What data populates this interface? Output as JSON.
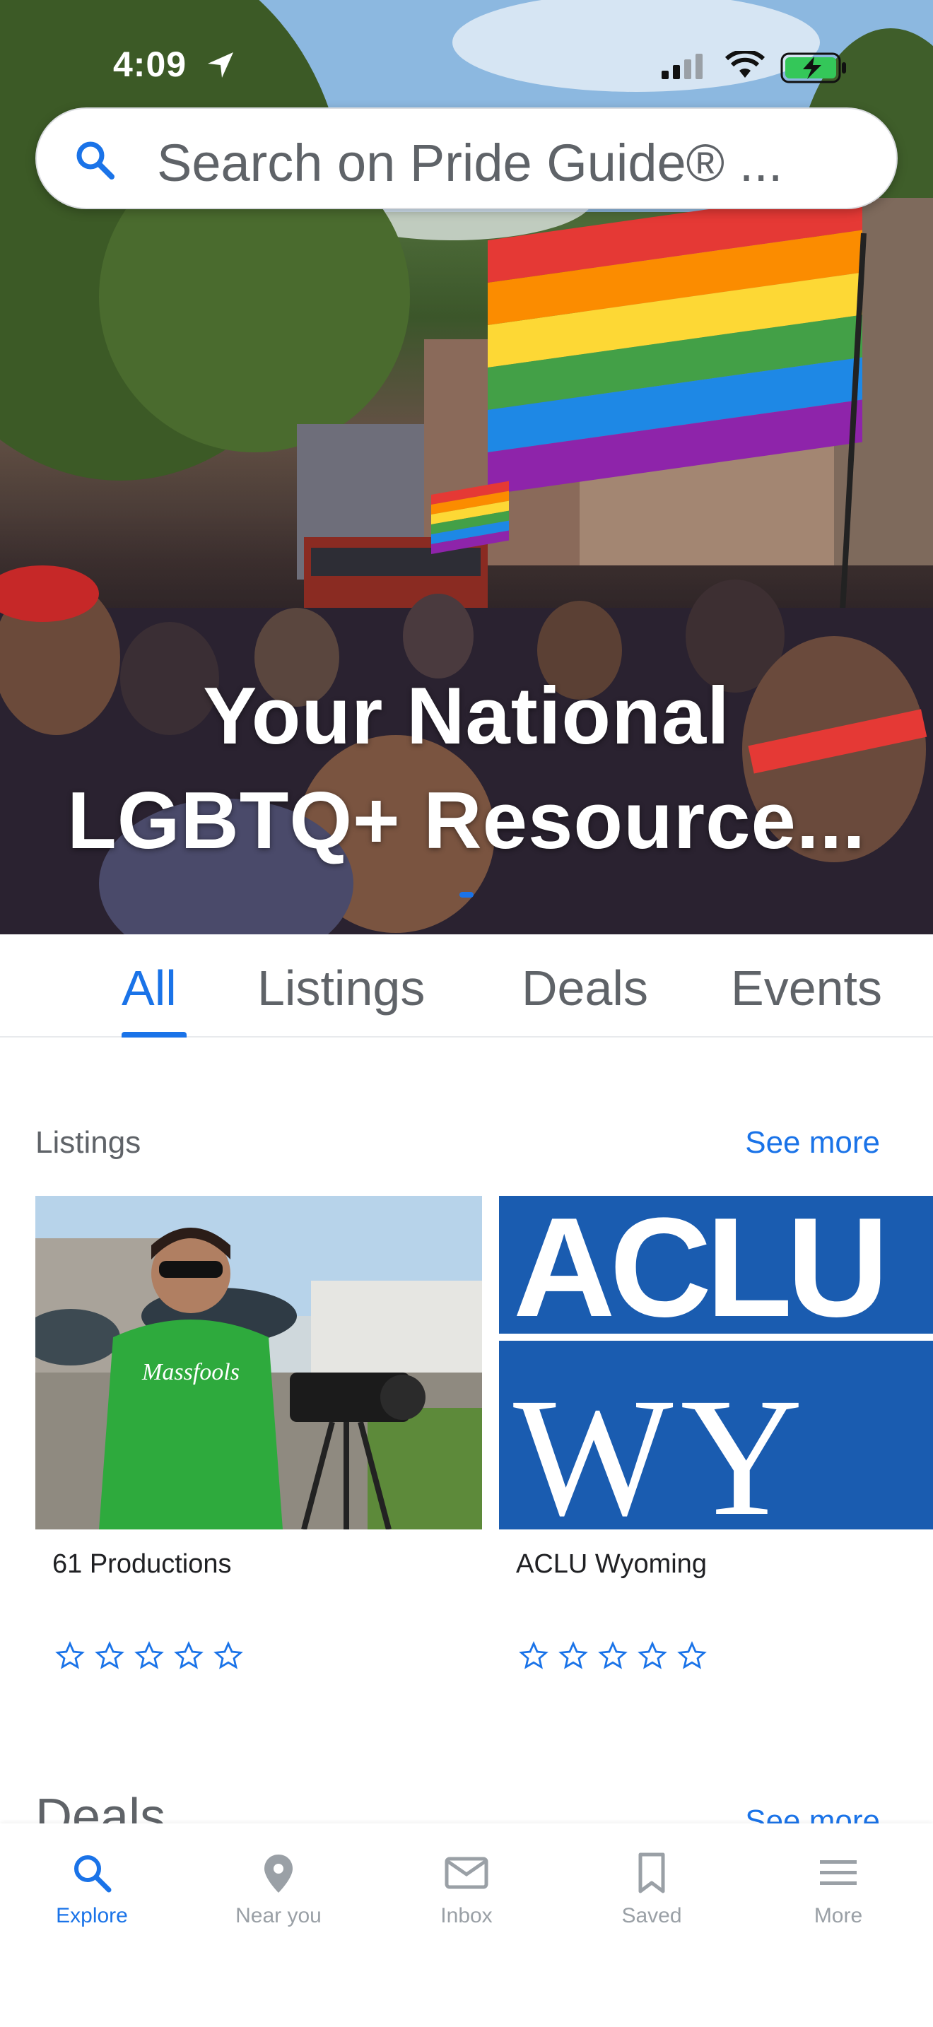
{
  "status_bar": {
    "time": "4:09"
  },
  "search": {
    "placeholder": "Search on Pride Guide® ..."
  },
  "hero": {
    "title_line1": "Your National",
    "title_line2": "LGBTQ+ Resource..."
  },
  "tabs": [
    {
      "label": "All",
      "active": true
    },
    {
      "label": "Listings",
      "active": false
    },
    {
      "label": "Deals",
      "active": false
    },
    {
      "label": "Events",
      "active": false
    }
  ],
  "listings": {
    "title": "Listings",
    "see_more": "See more",
    "cards": [
      {
        "name": "61 Productions",
        "rating": 0,
        "max_rating": 5,
        "shirt_text": "Massfools"
      },
      {
        "name": "ACLU Wyoming",
        "rating": 0,
        "max_rating": 5,
        "logo_line1": "ACLU",
        "logo_line2": "WY"
      }
    ]
  },
  "deals": {
    "title": "Deals",
    "see_more": "See more"
  },
  "bottom_nav": [
    {
      "label": "Explore",
      "icon": "search-icon",
      "active": true
    },
    {
      "label": "Near you",
      "icon": "location-pin-icon",
      "active": false
    },
    {
      "label": "Inbox",
      "icon": "mail-icon",
      "active": false
    },
    {
      "label": "Saved",
      "icon": "bookmark-icon",
      "active": false
    },
    {
      "label": "More",
      "icon": "menu-icon",
      "active": false
    }
  ],
  "colors": {
    "accent": "#1a73e8",
    "inactive": "#9aa0a6",
    "text_secondary": "#5f6368"
  }
}
